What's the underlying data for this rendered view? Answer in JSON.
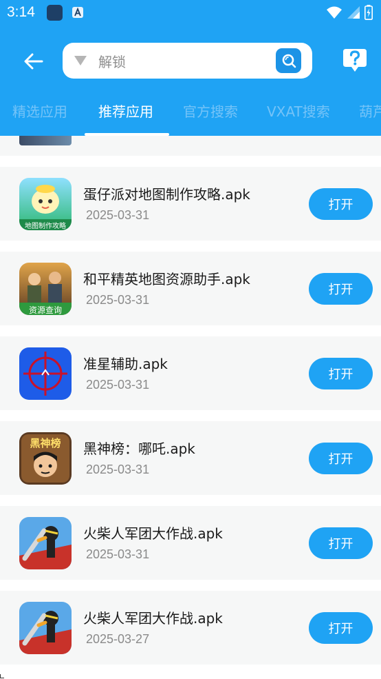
{
  "status_bar": {
    "time": "3:14"
  },
  "header": {
    "search_query": "解锁",
    "tabs": [
      {
        "label": "精选应用",
        "active": false
      },
      {
        "label": "推荐应用",
        "active": true
      },
      {
        "label": "官方搜索",
        "active": false
      },
      {
        "label": "VXAT搜索",
        "active": false
      },
      {
        "label": "葫芦",
        "active": false
      }
    ]
  },
  "items": [
    {
      "name": "蛋仔派对地图制作攻略.apk",
      "date": "2025-03-31",
      "action": "打开",
      "icon": "eggy-party-map-icon",
      "icon_caption": "地图制作攻略"
    },
    {
      "name": "和平精英地图资源助手.apk",
      "date": "2025-03-31",
      "action": "打开",
      "icon": "peace-elite-icon",
      "icon_caption": "资源查询"
    },
    {
      "name": "准星辅助.apk",
      "date": "2025-03-31",
      "action": "打开",
      "icon": "crosshair-icon"
    },
    {
      "name": "黑神榜：哪吒.apk",
      "date": "2025-03-31",
      "action": "打开",
      "icon": "black-myth-nezha-icon",
      "icon_caption": "黑神榜"
    },
    {
      "name": "火柴人军团大作战.apk",
      "date": "2025-03-31",
      "action": "打开",
      "icon": "stickman-legion-icon"
    },
    {
      "name": "火柴人军团大作战.apk",
      "date": "2025-03-27",
      "action": "打开",
      "icon": "stickman-legion-icon"
    }
  ],
  "colors": {
    "primary": "#1fa3f4",
    "card_bg": "#f6f7f7",
    "tab_inactive": "#74c3f8"
  }
}
